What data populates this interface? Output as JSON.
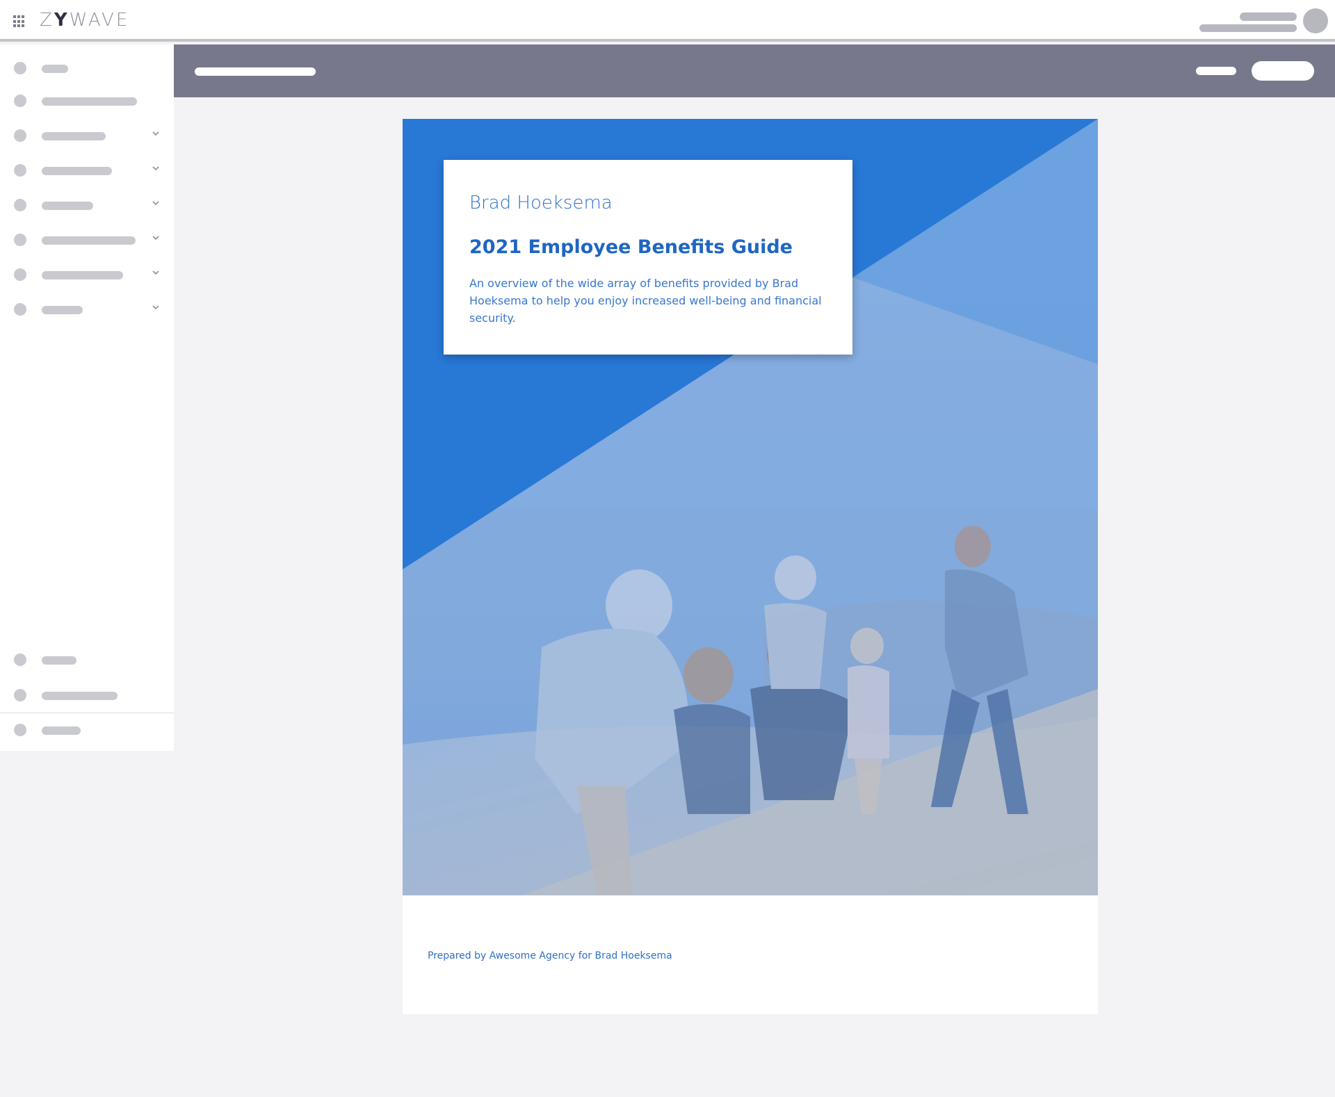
{
  "app": {
    "brand": {
      "prefix": "Z",
      "accent": "Y",
      "suffix": "WAVE"
    }
  },
  "colors": {
    "accent_blue": "#2878d6",
    "toolbar": "#78788c",
    "placeholder": "#c9cad0"
  },
  "icons": [
    "apps-grid-icon",
    "chevron-down-icon"
  ],
  "document": {
    "company_name": "Brad Hoeksema",
    "title": "2021 Employee Benefits Guide",
    "description": "An overview of the wide array of benefits provided by Brad Hoeksema to help you enjoy increased well-being and financial security.",
    "prepared_by": "Prepared by Awesome Agency for Brad Hoeksema"
  }
}
